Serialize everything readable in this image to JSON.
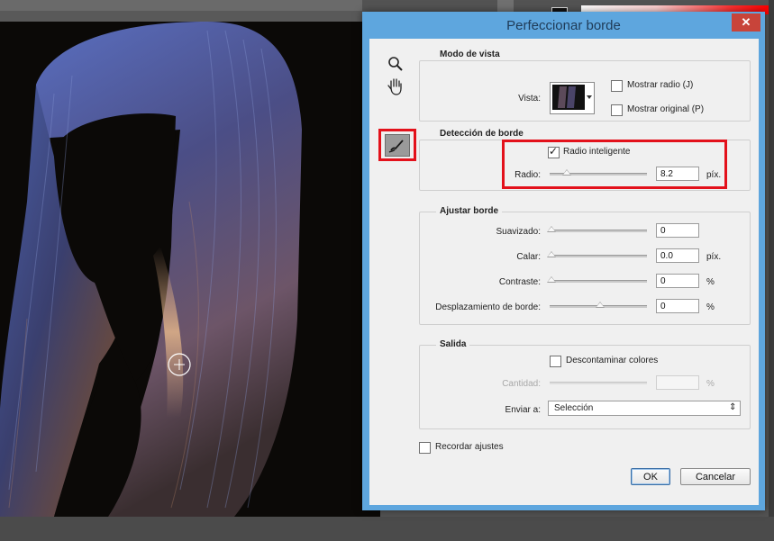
{
  "dialog": {
    "title": "Perfeccionar borde",
    "close_glyph": "✕"
  },
  "tools": {
    "zoom": "zoom-icon",
    "hand": "hand-icon",
    "refine_radius": "refine-radius-brush-icon"
  },
  "view_mode": {
    "title": "Modo de vista",
    "view_label": "Vista:",
    "show_radius_label": "Mostrar radio (J)",
    "show_original_label": "Mostrar original (P)",
    "show_radius_checked": false,
    "show_original_checked": false
  },
  "edge_detection": {
    "title": "Detección de borde",
    "smart_radius_label": "Radio inteligente",
    "smart_radius_checked": true,
    "radius_label": "Radio:",
    "radius_value": "8.2",
    "radius_unit": "píx.",
    "radius_level": 0.16
  },
  "adjust_edge": {
    "title": "Ajustar borde",
    "rows": [
      {
        "label": "Suavizado:",
        "value": "0",
        "unit": "",
        "level": 0.0
      },
      {
        "label": "Calar:",
        "value": "0.0",
        "unit": "píx.",
        "level": 0.0
      },
      {
        "label": "Contraste:",
        "value": "0",
        "unit": "%",
        "level": 0.0
      },
      {
        "label": "Desplazamiento de borde:",
        "value": "0",
        "unit": "%",
        "level": 0.5
      }
    ]
  },
  "output": {
    "title": "Salida",
    "decontaminate_label": "Descontaminar colores",
    "decontaminate_checked": false,
    "amount_label": "Cantidad:",
    "amount_value": "",
    "amount_unit": "%",
    "send_to_label": "Enviar a:",
    "send_to_value": "Selección",
    "send_to_arrow": "⇕"
  },
  "remember_label": "Recordar ajustes",
  "remember_checked": false,
  "buttons": {
    "ok": "OK",
    "cancel": "Cancelar"
  },
  "colors": {
    "highlight": "#e3111b",
    "titlebar": "#5ea6de"
  }
}
